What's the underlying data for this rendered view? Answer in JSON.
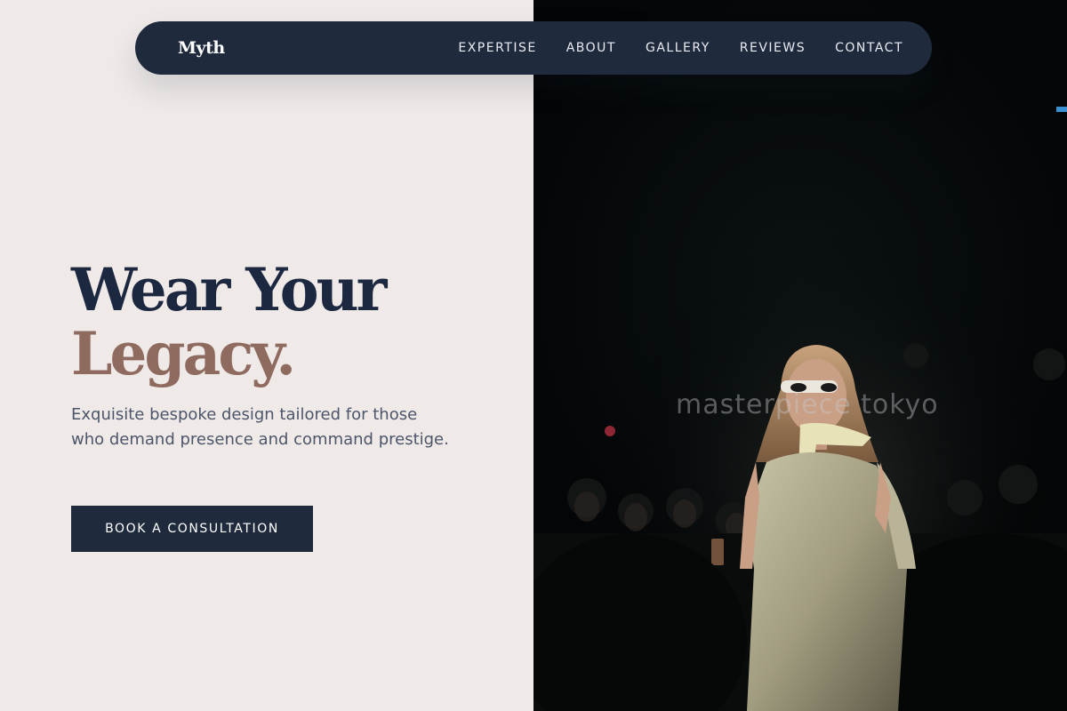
{
  "nav": {
    "brand": "Myth",
    "links": [
      "EXPERTISE",
      "ABOUT",
      "GALLERY",
      "REVIEWS",
      "CONTACT"
    ]
  },
  "hero": {
    "title_line1": "Wear Your",
    "title_line2": "Legacy.",
    "subtitle": "Exquisite bespoke design tailored for those who demand presence and command prestige.",
    "cta_label": "BOOK A CONSULTATION"
  },
  "photo": {
    "watermark": "masterpiece tokyo"
  },
  "colors": {
    "navy": "#1f2a3d",
    "accent_brown": "#8e6a5f",
    "background": "#efe9e8",
    "body_text": "#4c5569"
  }
}
